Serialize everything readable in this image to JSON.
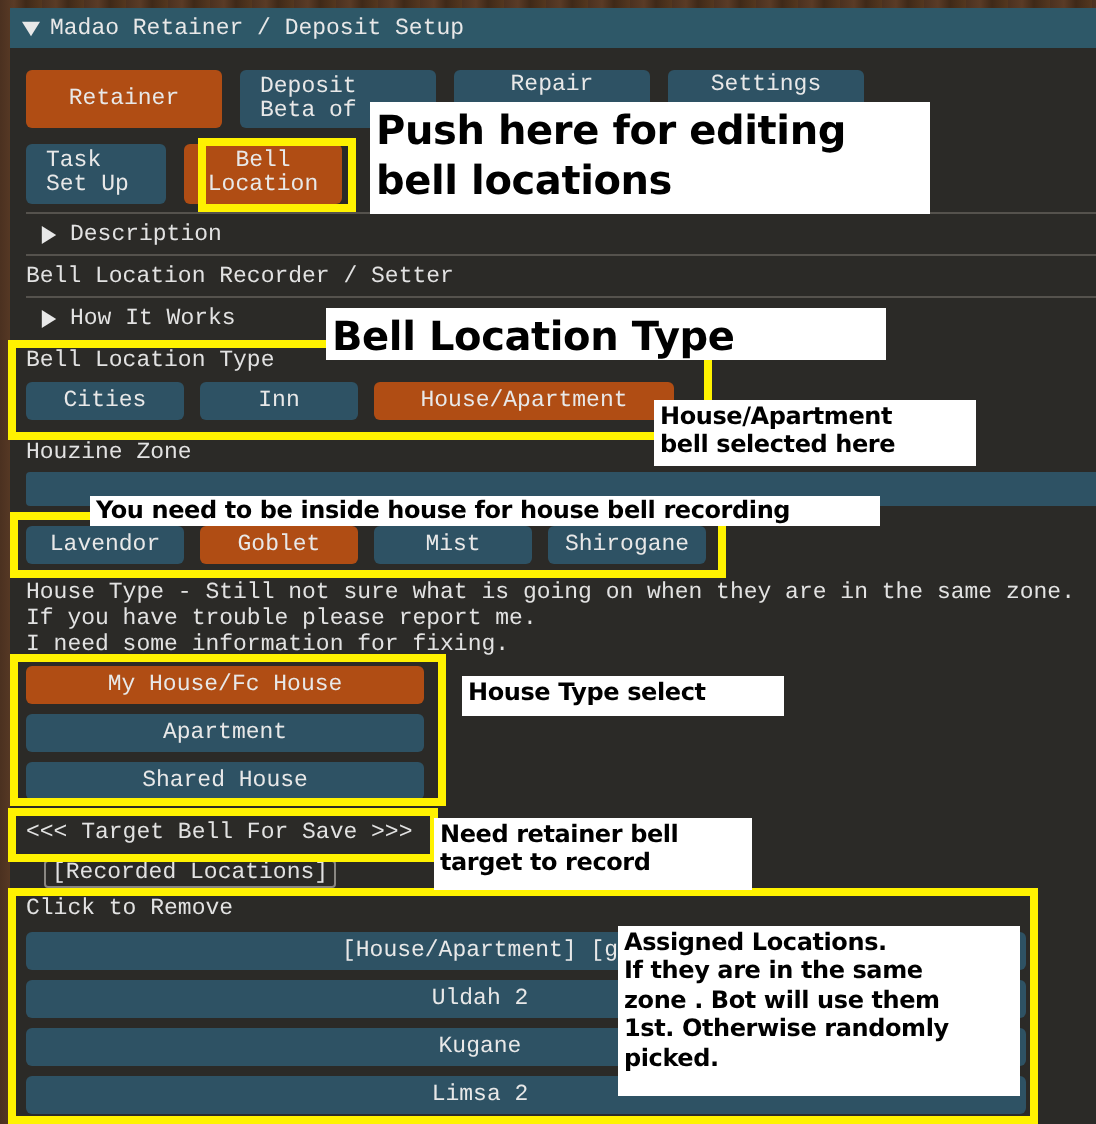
{
  "window": {
    "title": "Madao Retainer / Deposit Setup",
    "expanded": true
  },
  "main_tabs": [
    {
      "label": "Retainer",
      "selected": true
    },
    {
      "label": "Deposit\nBeta of",
      "selected": false
    },
    {
      "label": "Repair",
      "selected": false
    },
    {
      "label": "Settings",
      "selected": false
    }
  ],
  "sub_tabs": [
    {
      "label": "Task\nSet Up",
      "selected": false
    },
    {
      "label": "Bell\nLocation",
      "selected": true
    }
  ],
  "description": {
    "label": "Description",
    "expanded": false
  },
  "recorder_heading": "Bell Location Recorder / Setter",
  "how_it_works": {
    "label": "How It Works",
    "expanded": false
  },
  "bell_location_type": {
    "label": "Bell Location Type",
    "options": [
      {
        "label": "Cities",
        "selected": false
      },
      {
        "label": "Inn",
        "selected": false
      },
      {
        "label": "House/Apartment",
        "selected": true
      }
    ]
  },
  "housing_zone": {
    "label": "Houzine Zone",
    "options": [
      {
        "label": "Lavendor",
        "selected": false
      },
      {
        "label": "Goblet",
        "selected": true
      },
      {
        "label": "Mist",
        "selected": false
      },
      {
        "label": "Shirogane",
        "selected": false
      }
    ]
  },
  "house_type_note": [
    "House Type - Still not sure what is going on when they are in the same zone.",
    "If you have trouble please report me.",
    "I need some information for fixing."
  ],
  "house_types": [
    {
      "label": "My House/Fc House",
      "selected": true
    },
    {
      "label": "Apartment",
      "selected": false
    },
    {
      "label": "Shared House",
      "selected": false
    }
  ],
  "target_bell_button": "<<< Target Bell For Save >>>",
  "recorded_locations": {
    "label": "[Recorded Locations]",
    "hint": "Click to Remove",
    "items": [
      "[House/Apartment] [g",
      "Uldah 2",
      "Kugane",
      "Limsa 2"
    ]
  },
  "annotations": [
    "Push here for editing\nbell locations",
    "Bell Location Type",
    "House/Apartment\nbell selected here",
    "You need to be inside house for house bell recording",
    "House Type select",
    "Need retainer bell\ntarget to record",
    "Assigned Locations.\nIf they are in the same\nzone . Bot will use them\n1st. Otherwise randomly\npicked."
  ]
}
